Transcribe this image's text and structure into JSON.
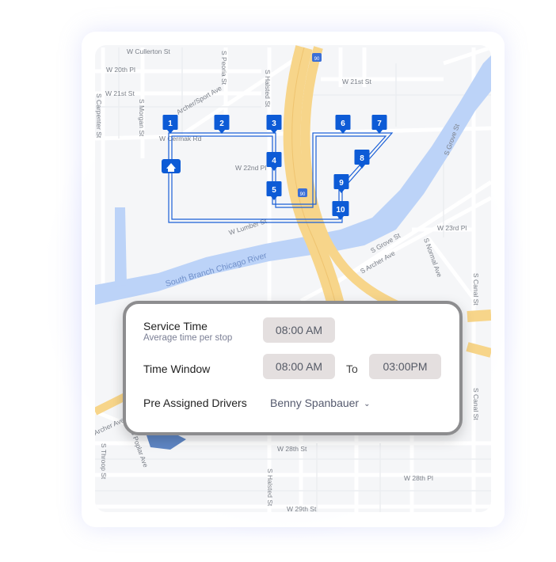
{
  "colors": {
    "route": "#1a5fd6",
    "pin": "#0d5bd6",
    "highway": "#f7d58a",
    "river": "#bcd3f8",
    "panel_border": "#8d8d8f",
    "field_bg": "#e4dfdf"
  },
  "map": {
    "street_labels": [
      "W Cullerton St",
      "W 20th Pl",
      "W 21st St",
      "S Carpenter St",
      "S Morgan St",
      "S Peoria St",
      "S Halsted St",
      "W 21st St",
      "Archer/Sport Ave",
      "W Cermak Rd",
      "W 22nd Pl",
      "W Lumber St",
      "S Grove St",
      "W 23rd Pl",
      "S Grove St",
      "S Archer Ave",
      "S Normal Ave",
      "S Canal St",
      "S Canal St",
      "W 28th St",
      "W 28th Pl",
      "W 29th St",
      "S Halsted St",
      "S Throop St",
      "S Poplar Ave",
      "Archer Ave"
    ],
    "river_label": "South Branch Chicago River",
    "highway_shield": "90",
    "stops": [
      "1",
      "2",
      "3",
      "4",
      "5",
      "6",
      "7",
      "8",
      "9",
      "10"
    ],
    "depot_icon": "home-icon"
  },
  "panel": {
    "service_time_label": "Service Time",
    "service_time_sub": "Average time per stop",
    "service_time_value": "08:00 AM",
    "time_window_label": "Time Window",
    "time_window_from": "08:00 AM",
    "to_label": "To",
    "time_window_to": "03:00PM",
    "drivers_label": "Pre Assigned Drivers",
    "drivers_value": "Benny Spanbauer",
    "dropdown_icon": "chevron-down-icon"
  }
}
